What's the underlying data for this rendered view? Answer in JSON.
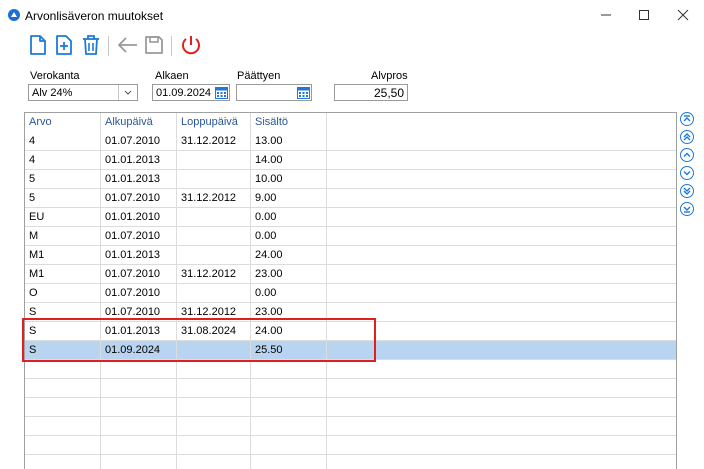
{
  "window": {
    "title": "Arvonlisäveron muutokset"
  },
  "toolbar": {
    "icons": [
      "new-icon",
      "add-icon",
      "delete-icon",
      "undo-icon",
      "save-icon",
      "power-icon"
    ]
  },
  "form": {
    "verokanta_label": "Verokanta",
    "verokanta_value": "Alv 24%",
    "alkaen_label": "Alkaen",
    "alkaen_value": "01.09.2024",
    "paattyen_label": "Päättyen",
    "paattyen_value": "",
    "alvpros_label": "Alvpros",
    "alvpros_value": "25,50"
  },
  "grid": {
    "columns": [
      "Arvo",
      "Alkupäivä",
      "Loppupäivä",
      "Sisältö"
    ],
    "rows": [
      [
        "4",
        "01.07.2010",
        "31.12.2012",
        "13.00"
      ],
      [
        "4",
        "01.01.2013",
        "",
        "14.00"
      ],
      [
        "5",
        "01.01.2013",
        "",
        "10.00"
      ],
      [
        "5",
        "01.07.2010",
        "31.12.2012",
        "9.00"
      ],
      [
        "EU",
        "01.01.2010",
        "",
        "0.00"
      ],
      [
        "M",
        "01.07.2010",
        "",
        "0.00"
      ],
      [
        "M1",
        "01.01.2013",
        "",
        "24.00"
      ],
      [
        "M1",
        "01.07.2010",
        "31.12.2012",
        "23.00"
      ],
      [
        "O",
        "01.07.2010",
        "",
        "0.00"
      ],
      [
        "S",
        "01.07.2010",
        "31.12.2012",
        "23.00"
      ],
      [
        "S",
        "01.01.2013",
        "31.08.2024",
        "24.00"
      ],
      [
        "S",
        "01.09.2024",
        "",
        "25.50"
      ]
    ],
    "selected_row": 11,
    "empty_rows": 6
  },
  "colors": {
    "accent": "#1e7ad6",
    "selection": "#b8d4f0",
    "highlight": "#e02020",
    "header_text": "#2b5797"
  }
}
